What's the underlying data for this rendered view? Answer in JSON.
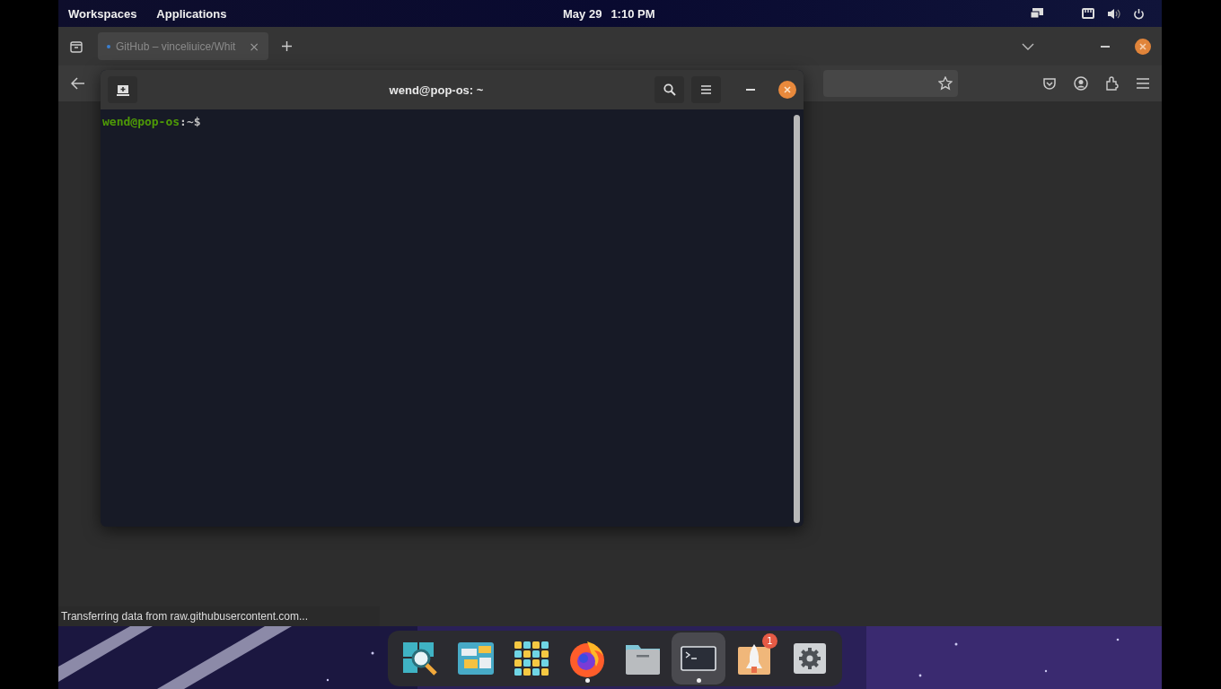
{
  "top_bar": {
    "workspaces": "Workspaces",
    "applications": "Applications",
    "date": "May 29",
    "time": "1:10 PM"
  },
  "browser": {
    "tabs": [
      {
        "title": "GitHub – vinceliuice/Whit",
        "selected": true,
        "close": "×"
      }
    ],
    "status": "Transferring data from raw.githubusercontent.com..."
  },
  "terminal": {
    "title": "wend@pop-os: ~",
    "prompt_user": "wend@pop-os",
    "prompt_rest": ":~$"
  },
  "dock": [
    {
      "kind": "search",
      "selected": false,
      "running": false
    },
    {
      "kind": "windows",
      "selected": false,
      "running": false
    },
    {
      "kind": "grid",
      "selected": false,
      "running": false
    },
    {
      "kind": "firefox",
      "selected": false,
      "running": true
    },
    {
      "kind": "folder",
      "selected": false,
      "running": false
    },
    {
      "kind": "terminal",
      "selected": true,
      "running": true
    },
    {
      "kind": "rocket",
      "selected": false,
      "running": false,
      "badge": "1"
    },
    {
      "kind": "gear",
      "selected": false,
      "running": false
    }
  ]
}
